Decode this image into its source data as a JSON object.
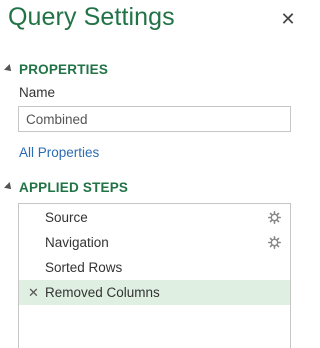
{
  "pane": {
    "title": "Query Settings",
    "close_glyph": "✕"
  },
  "properties": {
    "section_label": "PROPERTIES",
    "name_label": "Name",
    "name_value": "Combined",
    "all_properties_link": "All Properties"
  },
  "applied_steps": {
    "section_label": "APPLIED STEPS",
    "steps": [
      {
        "label": "Source",
        "has_settings": true,
        "selected": false
      },
      {
        "label": "Navigation",
        "has_settings": true,
        "selected": false
      },
      {
        "label": "Sorted Rows",
        "has_settings": false,
        "selected": false
      },
      {
        "label": "Removed Columns",
        "has_settings": false,
        "selected": true,
        "delete_glyph": "✕"
      }
    ]
  },
  "colors": {
    "accent": "#217346",
    "link": "#2b6cb3",
    "selected_row": "#dff0e3"
  }
}
